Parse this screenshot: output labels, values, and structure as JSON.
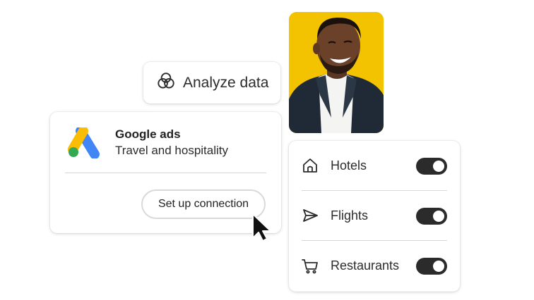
{
  "analyze": {
    "label": "Analyze data",
    "icon": "venn-diagram-icon"
  },
  "photo": {
    "description_icon": "person-photo",
    "background_color": "#f3c200"
  },
  "google_ads": {
    "title": "Google ads",
    "subtitle": "Travel and hospitality",
    "button_label": "Set up connection",
    "logo_colors": {
      "blue": "#4285f4",
      "yellow": "#fbbc04",
      "green": "#34a853"
    }
  },
  "toggles": [
    {
      "label": "Hotels",
      "icon": "home-icon",
      "on": true
    },
    {
      "label": "Flights",
      "icon": "send-icon",
      "on": true
    },
    {
      "label": "Restaurants",
      "icon": "cart-icon",
      "on": true
    }
  ],
  "colors": {
    "toggle_on": "#2b2b2b",
    "text": "#2c2c2c"
  }
}
